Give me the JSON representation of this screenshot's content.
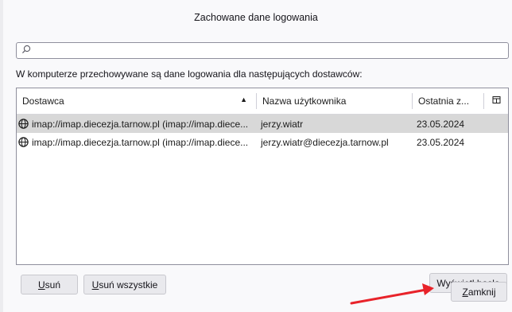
{
  "dialog": {
    "title": "Zachowane dane logowania"
  },
  "search": {
    "value": "",
    "placeholder": ""
  },
  "intro_text": "W komputerze przechowywane są dane logowania dla następujących dostawców:",
  "table": {
    "columns": {
      "provider": "Dostawca",
      "user": "Nazwa użytkownika",
      "date": "Ostatnia z..."
    },
    "rows": [
      {
        "provider": "imap://imap.diecezja.tarnow.pl (imap://imap.diece...",
        "user": "jerzy.wiatr",
        "date": "23.05.2024",
        "selected": true
      },
      {
        "provider": "imap://imap.diecezja.tarnow.pl (imap://imap.diece...",
        "user": "jerzy.wiatr@diecezja.tarnow.pl",
        "date": "23.05.2024",
        "selected": false
      }
    ]
  },
  "buttons": {
    "remove": {
      "accel": "U",
      "rest": "suń"
    },
    "remove_all": {
      "accel": "U",
      "rest": "suń wszystkie"
    },
    "show_passwords": {
      "before": "Wyświetl ",
      "accel": "h",
      "rest": "asła"
    },
    "close": {
      "accel": "Z",
      "rest": "amknij"
    }
  },
  "icons": {
    "search": "search-icon",
    "provider": "globe-icon",
    "sort": "sort-ascending-icon",
    "column_picker": "column-picker-icon"
  },
  "colors": {
    "selected_row": "#d8d8d8",
    "annotation_arrow": "#e8232a"
  }
}
